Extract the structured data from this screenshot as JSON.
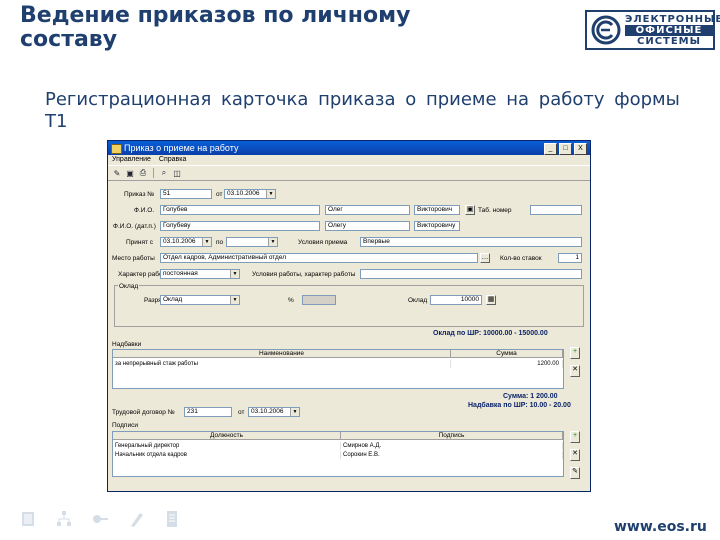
{
  "slide": {
    "title": "Ведение приказов по личному\nсоставу",
    "subtitle": "Регистрационная карточка приказа о приеме на работу формы Т1",
    "logo_lines": [
      "ЭЛЕКТРОННЫЕ",
      "ОФИСНЫЕ",
      "СИСТЕМЫ"
    ],
    "website": "www.eos.ru",
    "footer_icons": [
      "book-icon",
      "hierarchy-icon",
      "key-icon",
      "pen-icon",
      "document-icon"
    ]
  },
  "window": {
    "title": "Приказ о приеме на работу",
    "buttons": [
      "_",
      "□",
      "X"
    ],
    "menu": [
      "Управление",
      "Справка"
    ],
    "toolbar_icons": [
      "edit-icon",
      "save-icon",
      "print-icon",
      "find-icon",
      "preview-icon"
    ]
  },
  "form": {
    "order_no_label": "Приказ №",
    "order_no_value": "51",
    "order_date_label": "от",
    "order_date_value": "03.10.2006",
    "fio_label": "Ф.И.О.",
    "last_name": "Голубев",
    "first_name": "Олег",
    "middle_name": "Викторович",
    "tab_no_label": "Таб. номер",
    "tab_no_value": "",
    "fio_dat_label": "Ф.И.О. (дат.п.)",
    "last_name_dat": "Голубеву",
    "first_name_dat": "Олегу",
    "middle_name_dat": "Викторовичу",
    "hire_from_label": "Принят с",
    "hire_from_value": "03.10.2006",
    "hire_to_label": "по",
    "hire_to_value": "",
    "condition_label": "Условия приема",
    "condition_value": "Впервые",
    "workplace_label": "Место работы",
    "workplace_value": "Отдел кадров, Административный отдел",
    "rate_label": "Кол-во ставок",
    "rate_value": "1",
    "character_label": "Характер работы",
    "character_value": "постоянная",
    "work_conditions_label": "Условия работы, характер работы",
    "work_conditions_value": "",
    "section_salary_label": "Оклад",
    "grade_label": "Разряд",
    "grade_value": "Оклад",
    "percent_label": "%",
    "salary_label": "Оклад",
    "salary_value": "10000",
    "salary_range": "Оклад по ШР: 10000.00 - 15000.00",
    "allowances_label": "Надбавки",
    "allowance_columns": [
      "Наименование",
      "Сумма"
    ],
    "allowance_rows": [
      {
        "name": "за непрерывный стаж работы",
        "sum": "1200.00"
      }
    ],
    "allowance_total": "Сумма: 1 200.00",
    "allowance_range": "Надбавка по ШР: 10.00 - 20.00",
    "contract_label": "Трудовой договор №",
    "contract_no": "231",
    "contract_date_label": "от",
    "contract_date": "03.10.2006",
    "signatures_label": "Подписи",
    "signature_columns": [
      "Должность",
      "Подпись"
    ],
    "signature_rows": [
      {
        "position": "Генеральный директор",
        "signature": "Смирнов А.Д."
      },
      {
        "position": "Начальник отдела кадров",
        "signature": "Сорокин Е.В."
      }
    ]
  }
}
